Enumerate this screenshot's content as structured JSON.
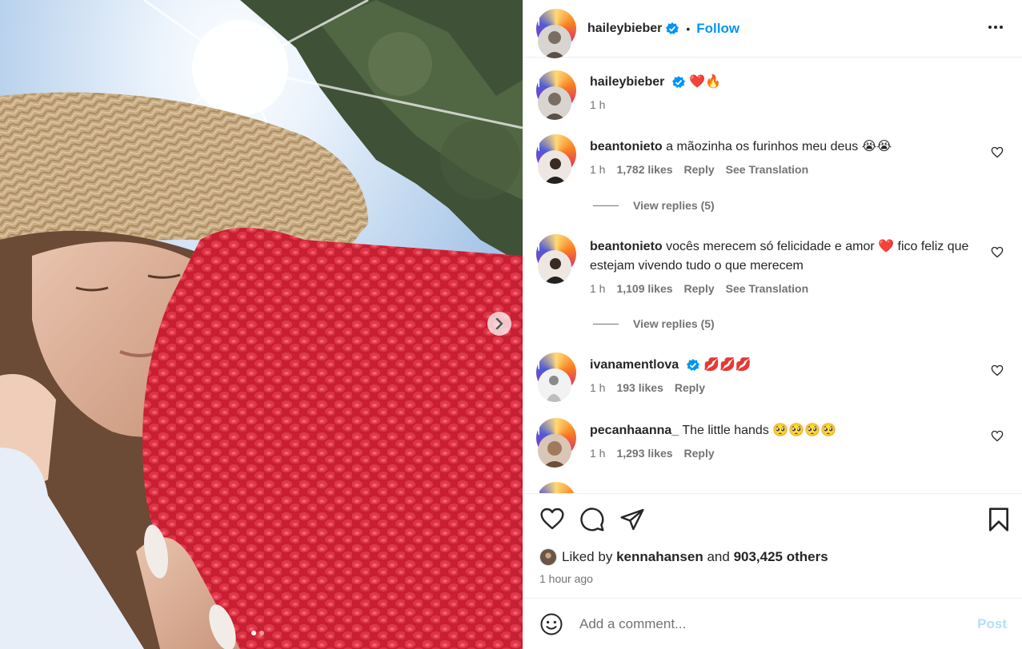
{
  "post": {
    "carousel": {
      "slides": 2,
      "active_slide": 1,
      "next_icon": "chevron-right-icon"
    },
    "header": {
      "username": "haileybieber",
      "verified": true,
      "separator": "•",
      "follow_label": "Follow",
      "more_icon": "more-horizontal-icon"
    },
    "caption": {
      "username": "haileybieber",
      "text": "❤️🔥",
      "time": "1 h"
    },
    "comments": [
      {
        "username": "beantonieto",
        "text": "a mãozinha os furinhos meu deus 😭😭",
        "time": "1 h",
        "likes": "1,782 likes",
        "reply": "Reply",
        "translation": "See Translation",
        "view_replies": "View replies (5)"
      },
      {
        "username": "beantonieto",
        "text": "vocês merecem só felicidade e amor ❤️ fico feliz que estejam vivendo tudo o que merecem",
        "time": "1 h",
        "likes": "1,109 likes",
        "reply": "Reply",
        "translation": "See Translation",
        "view_replies": "View replies (5)"
      },
      {
        "username": "ivanamentlova",
        "verified": true,
        "text": "💋💋💋",
        "time": "1 h",
        "likes": "193 likes",
        "reply": "Reply"
      },
      {
        "username": "pecanhaanna_",
        "text": "The little hands 🥺🥺🥺🥺",
        "time": "1 h",
        "likes": "1,293 likes",
        "reply": "Reply"
      }
    ],
    "actions": {
      "like_icon": "heart-icon",
      "comment_icon": "comment-icon",
      "share_icon": "send-icon",
      "save_icon": "bookmark-icon"
    },
    "likes": {
      "prefix": "Liked by",
      "user": "kennahansen",
      "conj": "and",
      "others": "903,425 others"
    },
    "posted_time": "1 hour ago",
    "add_comment": {
      "placeholder": "Add a comment...",
      "post_label": "Post",
      "emoji_icon": "emoji-icon"
    }
  },
  "colors": {
    "link_blue": "#0095f6",
    "verified_blue": "#0095f6",
    "post_disabled": "#b2dffc",
    "secondary_text": "#737373",
    "knit_red": "#d92a3a"
  }
}
